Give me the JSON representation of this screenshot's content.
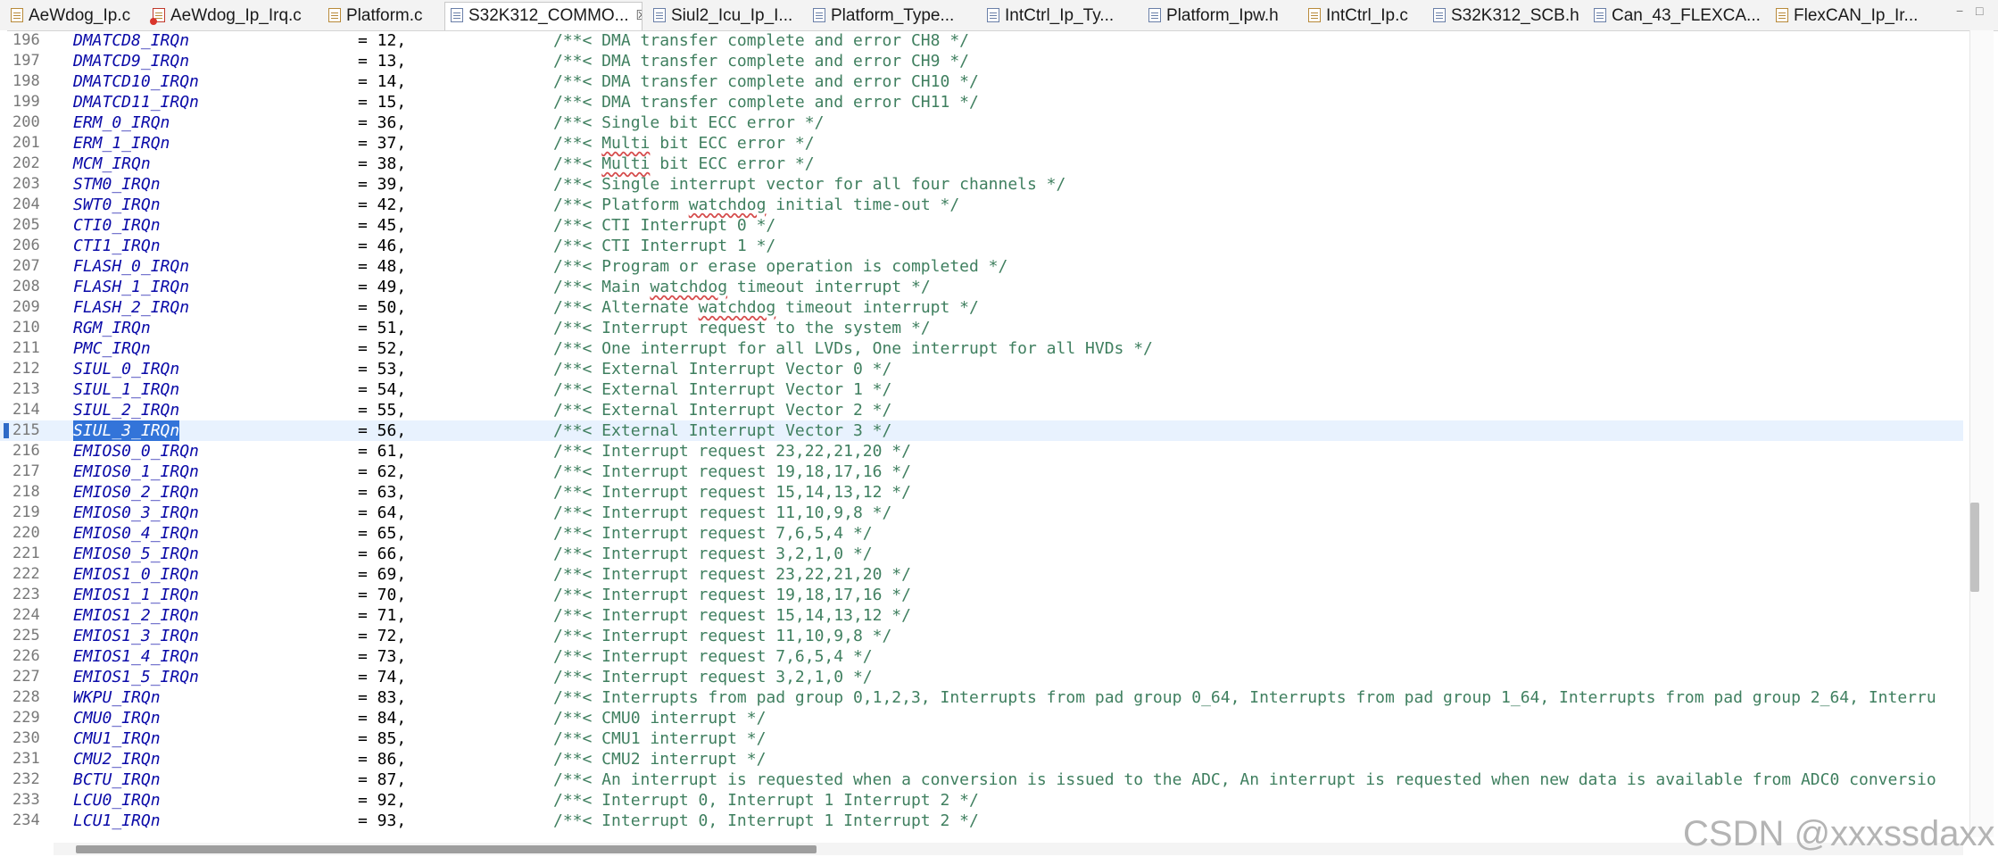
{
  "tabs": [
    {
      "label": "AeWdog_Ip.c",
      "icon": "c-file-icon",
      "active": false
    },
    {
      "label": "AeWdog_Ip_Irq.c",
      "icon": "c-file-error-icon",
      "active": false
    },
    {
      "label": "Platform.c",
      "icon": "c-file-icon",
      "active": false
    },
    {
      "label": "S32K312_COMMO...",
      "icon": "header-file-icon",
      "active": true,
      "close": "☒"
    },
    {
      "label": "Siul2_Icu_Ip_I...",
      "icon": "header-file-icon",
      "active": false
    },
    {
      "label": "Platform_Type...",
      "icon": "header-file-icon",
      "active": false
    },
    {
      "label": "IntCtrl_Ip_Ty...",
      "icon": "header-file-icon",
      "active": false
    },
    {
      "label": "Platform_Ipw.h",
      "icon": "header-file-icon",
      "active": false
    },
    {
      "label": "IntCtrl_Ip.c",
      "icon": "c-file-icon",
      "active": false
    },
    {
      "label": "S32K312_SCB.h",
      "icon": "header-file-icon",
      "active": false
    },
    {
      "label": "Can_43_FLEXCA...",
      "icon": "header-file-icon",
      "active": false
    },
    {
      "label": "FlexCAN_Ip_Ir...",
      "icon": "c-file-icon",
      "active": false
    }
  ],
  "window_controls": {
    "minimize": "−",
    "maximize": "□"
  },
  "editor": {
    "current_line": 215,
    "lines": [
      {
        "n": "196",
        "name": "DMATCD8_IRQn",
        "val": "= 12,",
        "comment": "/**< DMA transfer complete and error CH8 */"
      },
      {
        "n": "197",
        "name": "DMATCD9_IRQn",
        "val": "= 13,",
        "comment": "/**< DMA transfer complete and error CH9 */"
      },
      {
        "n": "198",
        "name": "DMATCD10_IRQn",
        "val": "= 14,",
        "comment": "/**< DMA transfer complete and error CH10 */"
      },
      {
        "n": "199",
        "name": "DMATCD11_IRQn",
        "val": "= 15,",
        "comment": "/**< DMA transfer complete and error CH11 */"
      },
      {
        "n": "200",
        "name": "ERM_0_IRQn",
        "val": "= 36,",
        "comment": "/**< Single bit ECC error */"
      },
      {
        "n": "201",
        "name": "ERM_1_IRQn",
        "val": "= 37,",
        "comment": "/**< Multi bit ECC error */"
      },
      {
        "n": "202",
        "name": "MCM_IRQn",
        "val": "= 38,",
        "comment": "/**< Multi bit ECC error */"
      },
      {
        "n": "203",
        "name": "STM0_IRQn",
        "val": "= 39,",
        "comment": "/**< Single interrupt vector for all four channels */"
      },
      {
        "n": "204",
        "name": "SWT0_IRQn",
        "val": "= 42,",
        "comment": "/**< Platform watchdog initial time-out */"
      },
      {
        "n": "205",
        "name": "CTI0_IRQn",
        "val": "= 45,",
        "comment": "/**< CTI Interrupt 0 */"
      },
      {
        "n": "206",
        "name": "CTI1_IRQn",
        "val": "= 46,",
        "comment": "/**< CTI Interrupt 1 */"
      },
      {
        "n": "207",
        "name": "FLASH_0_IRQn",
        "val": "= 48,",
        "comment": "/**< Program or erase operation is completed */"
      },
      {
        "n": "208",
        "name": "FLASH_1_IRQn",
        "val": "= 49,",
        "comment": "/**< Main watchdog timeout interrupt */"
      },
      {
        "n": "209",
        "name": "FLASH_2_IRQn",
        "val": "= 50,",
        "comment": "/**< Alternate watchdog timeout interrupt */"
      },
      {
        "n": "210",
        "name": "RGM_IRQn",
        "val": "= 51,",
        "comment": "/**< Interrupt request to the system */"
      },
      {
        "n": "211",
        "name": "PMC_IRQn",
        "val": "= 52,",
        "comment": "/**< One interrupt for all LVDs, One interrupt for all HVDs */"
      },
      {
        "n": "212",
        "name": "SIUL_0_IRQn",
        "val": "= 53,",
        "comment": "/**< External Interrupt Vector 0 */"
      },
      {
        "n": "213",
        "name": "SIUL_1_IRQn",
        "val": "= 54,",
        "comment": "/**< External Interrupt Vector 1 */"
      },
      {
        "n": "214",
        "name": "SIUL_2_IRQn",
        "val": "= 55,",
        "comment": "/**< External Interrupt Vector 2 */"
      },
      {
        "n": "215",
        "name": "SIUL_3_IRQn",
        "val": "= 56,",
        "comment": "/**< External Interrupt Vector 3 */"
      },
      {
        "n": "216",
        "name": "EMIOS0_0_IRQn",
        "val": "= 61,",
        "comment": "/**< Interrupt request 23,22,21,20 */"
      },
      {
        "n": "217",
        "name": "EMIOS0_1_IRQn",
        "val": "= 62,",
        "comment": "/**< Interrupt request 19,18,17,16 */"
      },
      {
        "n": "218",
        "name": "EMIOS0_2_IRQn",
        "val": "= 63,",
        "comment": "/**< Interrupt request 15,14,13,12 */"
      },
      {
        "n": "219",
        "name": "EMIOS0_3_IRQn",
        "val": "= 64,",
        "comment": "/**< Interrupt request 11,10,9,8 */"
      },
      {
        "n": "220",
        "name": "EMIOS0_4_IRQn",
        "val": "= 65,",
        "comment": "/**< Interrupt request 7,6,5,4 */"
      },
      {
        "n": "221",
        "name": "EMIOS0_5_IRQn",
        "val": "= 66,",
        "comment": "/**< Interrupt request 3,2,1,0 */"
      },
      {
        "n": "222",
        "name": "EMIOS1_0_IRQn",
        "val": "= 69,",
        "comment": "/**< Interrupt request 23,22,21,20 */"
      },
      {
        "n": "223",
        "name": "EMIOS1_1_IRQn",
        "val": "= 70,",
        "comment": "/**< Interrupt request 19,18,17,16 */"
      },
      {
        "n": "224",
        "name": "EMIOS1_2_IRQn",
        "val": "= 71,",
        "comment": "/**< Interrupt request 15,14,13,12 */"
      },
      {
        "n": "225",
        "name": "EMIOS1_3_IRQn",
        "val": "= 72,",
        "comment": "/**< Interrupt request 11,10,9,8 */"
      },
      {
        "n": "226",
        "name": "EMIOS1_4_IRQn",
        "val": "= 73,",
        "comment": "/**< Interrupt request 7,6,5,4 */"
      },
      {
        "n": "227",
        "name": "EMIOS1_5_IRQn",
        "val": "= 74,",
        "comment": "/**< Interrupt request 3,2,1,0 */"
      },
      {
        "n": "228",
        "name": "WKPU_IRQn",
        "val": "= 83,",
        "comment": "/**< Interrupts from pad group 0,1,2,3, Interrupts from pad group 0_64, Interrupts from pad group 1_64, Interrupts from pad group 2_64, Interru"
      },
      {
        "n": "229",
        "name": "CMU0_IRQn",
        "val": "= 84,",
        "comment": "/**< CMU0 interrupt */"
      },
      {
        "n": "230",
        "name": "CMU1_IRQn",
        "val": "= 85,",
        "comment": "/**< CMU1 interrupt */"
      },
      {
        "n": "231",
        "name": "CMU2_IRQn",
        "val": "= 86,",
        "comment": "/**< CMU2 interrupt */"
      },
      {
        "n": "232",
        "name": "BCTU_IRQn",
        "val": "= 87,",
        "comment": "/**< An interrupt is requested when a conversion is issued to the ADC, An interrupt is requested when new data is available from ADC0 conversio"
      },
      {
        "n": "233",
        "name": "LCU0_IRQn",
        "val": "= 92,",
        "comment": "/**< Interrupt 0, Interrupt 1 Interrupt 2 */"
      },
      {
        "n": "234",
        "name": "LCU1_IRQn",
        "val": "= 93,",
        "comment": "/**< Interrupt 0, Interrupt 1 Interrupt 2 */"
      }
    ]
  },
  "watermark": "CSDN @xxxssdaxx"
}
